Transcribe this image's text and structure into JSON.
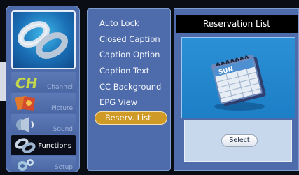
{
  "side_menu": {
    "items": [
      {
        "label": "Channel",
        "icon": "channel-icon"
      },
      {
        "label": "Picture",
        "icon": "picture-icon"
      },
      {
        "label": "Sound",
        "icon": "sound-icon"
      },
      {
        "label": "Functions",
        "icon": "functions-icon",
        "active": true
      },
      {
        "label": "Setup",
        "icon": "setup-icon"
      }
    ]
  },
  "options": {
    "items": [
      {
        "label": "Auto Lock"
      },
      {
        "label": "Closed Caption"
      },
      {
        "label": "Caption Option"
      },
      {
        "label": "Caption Text"
      },
      {
        "label": "CC Background"
      },
      {
        "label": "EPG View"
      },
      {
        "label": "Reserv. List",
        "selected": true
      }
    ]
  },
  "detail": {
    "title": "Reservation List",
    "preview_icon": "calendar-icon",
    "select_label": "Select"
  },
  "colors": {
    "panel": "#4e6bab",
    "panel_border": "#7f9ed0",
    "selected": "#d09a27",
    "active_bg": "#0b0e18"
  }
}
